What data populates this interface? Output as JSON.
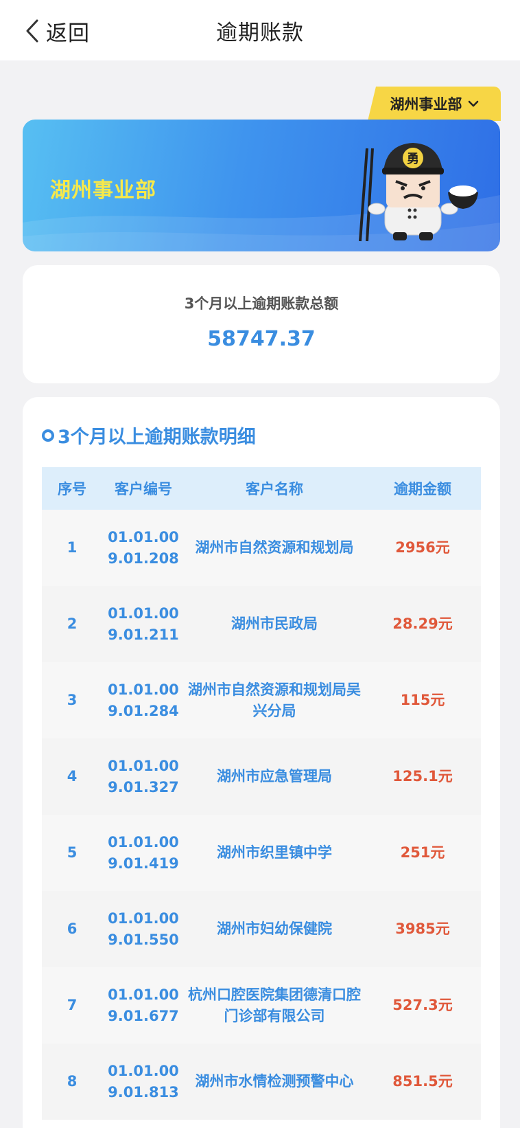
{
  "header": {
    "back_label": "返回",
    "title": "逾期账款"
  },
  "dept_selector": {
    "selected": "湖州事业部",
    "icon": "chevron-down-icon"
  },
  "banner": {
    "title": "湖州事业部",
    "colors": {
      "gradient_start": "#57bff2",
      "gradient_end": "#2f6fe6",
      "title": "#f7e94a"
    }
  },
  "summary": {
    "label": "3个月以上逾期账款总额",
    "value": "58747.37"
  },
  "detail": {
    "title": "3个月以上逾期账款明细",
    "columns": [
      "序号",
      "客户编号",
      "客户名称",
      "逾期金额"
    ],
    "rows": [
      {
        "no": "1",
        "code": "01.01.009.01.208",
        "name": "湖州市自然资源和规划局",
        "amount": "2956元"
      },
      {
        "no": "2",
        "code": "01.01.009.01.211",
        "name": "湖州市民政局",
        "amount": "28.29元"
      },
      {
        "no": "3",
        "code": "01.01.009.01.284",
        "name": "湖州市自然资源和规划局吴兴分局",
        "amount": "115元"
      },
      {
        "no": "4",
        "code": "01.01.009.01.327",
        "name": "湖州市应急管理局",
        "amount": "125.1元"
      },
      {
        "no": "5",
        "code": "01.01.009.01.419",
        "name": "湖州市织里镇中学",
        "amount": "251元"
      },
      {
        "no": "6",
        "code": "01.01.009.01.550",
        "name": "湖州市妇幼保健院",
        "amount": "3985元"
      },
      {
        "no": "7",
        "code": "01.01.009.01.677",
        "name": "杭州口腔医院集团德清口腔门诊部有限公司",
        "amount": "527.3元"
      },
      {
        "no": "8",
        "code": "01.01.009.01.813",
        "name": "湖州市水情检测预警中心",
        "amount": "851.5元"
      }
    ]
  },
  "colors": {
    "accent": "#3a8de0",
    "amount": "#e0583a",
    "selector_bg": "#f7d645"
  }
}
